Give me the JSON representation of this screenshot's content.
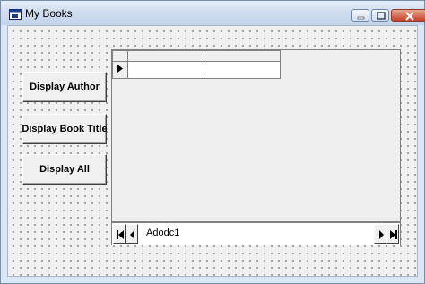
{
  "window": {
    "title": "My Books"
  },
  "buttons": {
    "display_author": "Display Author",
    "display_book_title": "Display Book Title",
    "display_all": "Display All"
  },
  "adodc": {
    "caption": "Adodc1"
  },
  "icons": [
    "app-icon",
    "minimize-icon",
    "maximize-icon",
    "close-icon",
    "row-selector-arrow-icon",
    "first-record-icon",
    "previous-record-icon",
    "next-record-icon",
    "last-record-icon"
  ]
}
